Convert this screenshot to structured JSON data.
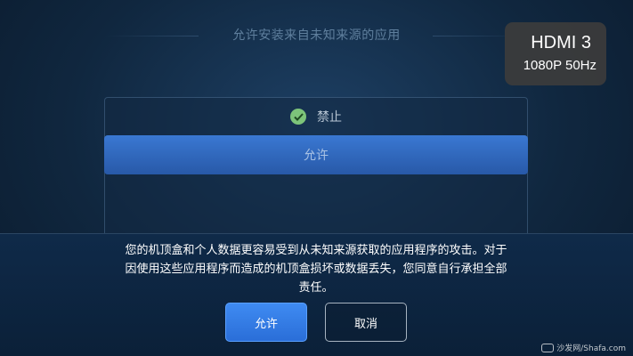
{
  "header": {
    "title": "允许安装来自未知来源的应用"
  },
  "hdmi": {
    "source": "HDMI 3",
    "resolution": "1080P 50Hz"
  },
  "options": {
    "forbid_label": "禁止",
    "allow_label": "允许",
    "selected": "禁止"
  },
  "dialog": {
    "lines": [
      "您的机顶盒和个人数据更容易受到从未知来源获取的应用程序的攻击。对于",
      "因使用这些应用程序而造成的机顶盒损坏或数据丢失，您同意自行承担全部",
      "责任。"
    ],
    "allow_button": "允许",
    "cancel_button": "取消"
  },
  "watermark": {
    "text": "沙发网/Shafa.com"
  },
  "colors": {
    "accent": "#3a7ee0",
    "check": "#7dc47a"
  }
}
